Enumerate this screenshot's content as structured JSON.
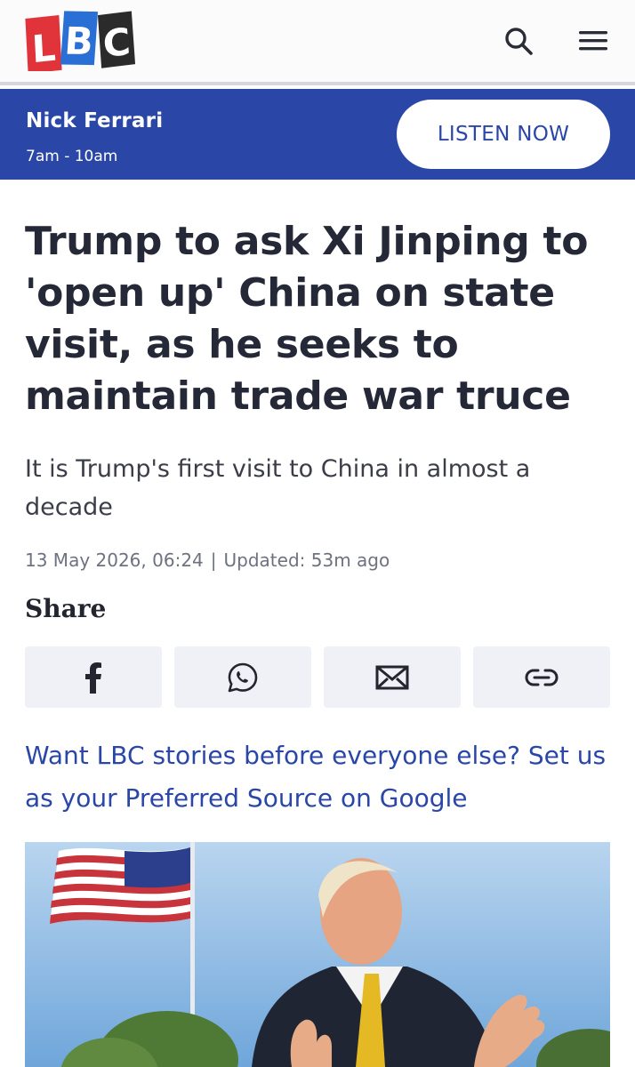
{
  "header": {
    "logo": {
      "letters": [
        "L",
        "B",
        "C"
      ],
      "colors": [
        "#e0343a",
        "#2a6fd6",
        "#2b2b2b"
      ]
    },
    "icons": {
      "search": "search-icon",
      "menu": "hamburger-menu-icon"
    }
  },
  "live_show": {
    "presenter": "Nick Ferrari",
    "time": "7am - 10am",
    "listen_label": "LISTEN NOW",
    "bar_color": "#2a47a8"
  },
  "article": {
    "headline": "Trump to ask Xi Jinping to 'open up' China on state visit, as he seeks to maintain trade war truce",
    "standfirst": "It is Trump's first visit to China in almost a decade",
    "published": "13 May 2026, 06:24",
    "separator": "|",
    "updated": "Updated: 53m ago",
    "share_title": "Share",
    "share_buttons": [
      {
        "name": "facebook",
        "icon": "facebook-icon"
      },
      {
        "name": "whatsapp",
        "icon": "whatsapp-icon"
      },
      {
        "name": "email",
        "icon": "email-icon"
      },
      {
        "name": "copy-link",
        "icon": "link-icon"
      }
    ],
    "preferred_source_link": "Want LBC stories before everyone else? Set us as your Preferred Source on Google",
    "hero_image": {
      "icon": "photo-icon"
    }
  },
  "colors": {
    "accent": "#2a47a8",
    "text": "#252836",
    "muted": "#6e7180",
    "share_bg": "#f0f1f6"
  }
}
